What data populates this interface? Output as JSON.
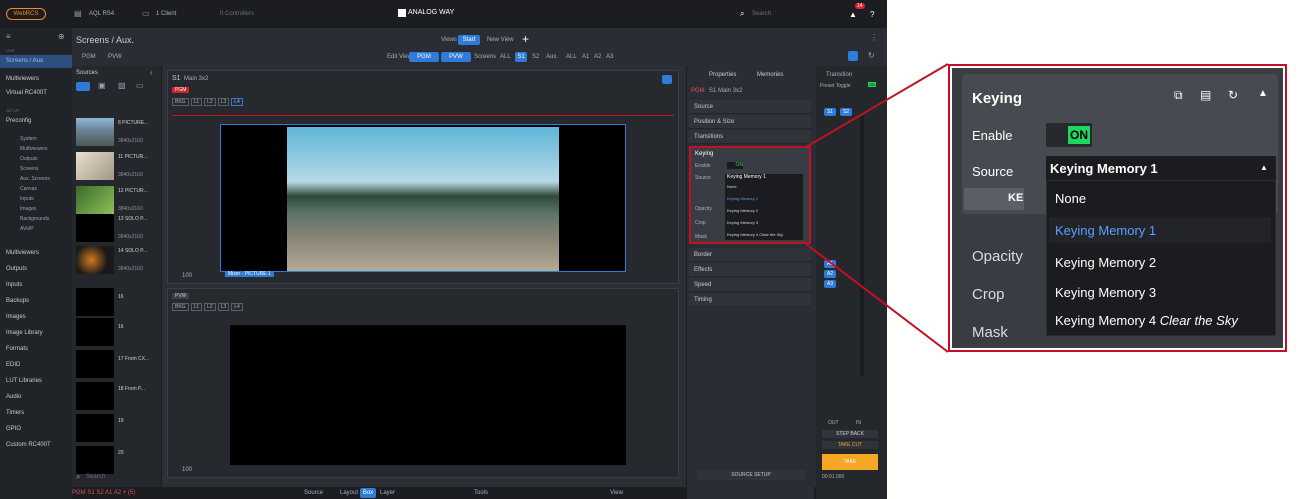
{
  "topbar": {
    "logo": "WebRCS",
    "device": "AQL RS4",
    "client": "1 Client",
    "controllers": "0 Controllers",
    "brand": "ANALOG WAY",
    "search_placeholder": "Search",
    "notif_count": "14"
  },
  "toolbar": {
    "section_title": "Screens / Aux.",
    "views_label": "Views",
    "start_label": "Start",
    "new_view": "New View",
    "pgm": "PGM",
    "pvw": "PVW",
    "edit_view": "Edit View",
    "screens_label": "Screens",
    "all": "ALL",
    "s1": "S1",
    "s2": "S2",
    "aux_label": "Aux.",
    "a1": "A1",
    "a2": "A2",
    "a3": "A3"
  },
  "nav": {
    "live_label": "LIVE",
    "items_top": [
      "Screens / Aux.",
      "Multiviewers",
      "Virtual RC400T"
    ],
    "setup_label": "SETUP",
    "preconfig": "Preconfig",
    "sub_items": [
      "System",
      "Multiviewers",
      "Outputs",
      "Screens",
      "Aux. Screens",
      "Canvas",
      "Inputs",
      "Images",
      "Backgrounds",
      "AVoIP"
    ],
    "items_bottom": [
      "Multiviewers",
      "Outputs",
      "Inputs",
      "Backups",
      "Images",
      "Image Library",
      "Formats",
      "EDID",
      "LUT Libraries",
      "Audio",
      "Timers",
      "GPIO",
      "Custom RC400T"
    ]
  },
  "sources": {
    "title": "Sources",
    "items": [
      {
        "name": "8 PICTURE...",
        "res": "3840x2160"
      },
      {
        "name": "11 PICTUR...",
        "res": "3840x2160"
      },
      {
        "name": "12 PICTUR...",
        "res": "3840x2160"
      },
      {
        "name": "13 SOLO P...",
        "res": "3840x2160"
      },
      {
        "name": "14 SOLO P...",
        "res": "3840x2160"
      },
      {
        "name": "16",
        "res": ""
      },
      {
        "name": "16",
        "res": ""
      },
      {
        "name": "17 From CX...",
        "res": ""
      },
      {
        "name": "18 From P...",
        "res": ""
      },
      {
        "name": "19",
        "res": ""
      },
      {
        "name": "20",
        "res": ""
      }
    ],
    "search": "Search"
  },
  "canvas": {
    "screen_title": "S1",
    "screen_name": "Main 3x2",
    "pgm_tag": "PGM",
    "layers": [
      "BKG",
      "L1",
      "L2",
      "L3",
      "L4"
    ],
    "layer_label": "Mixer",
    "layer_source": "PICTURE 1",
    "zoom": "100",
    "pvw_tag": "PVW"
  },
  "bottombar": {
    "pgm_list": "PGM S1 S2 A1 A2 + (5)",
    "source": "Source",
    "layout": "Layout",
    "box": "Box",
    "layer": "Layer",
    "tools": "Tools",
    "view": "View"
  },
  "props": {
    "properties": "Properties",
    "memories": "Memories",
    "screen_tag": "PGM",
    "screen_ref": "S1 Main 3x2",
    "rows": [
      "Source",
      "Position & Size",
      "Transitions"
    ],
    "rows_after": [
      "Border",
      "Effects",
      "Speed",
      "Timing"
    ],
    "source_setup": "SOURCE SETUP"
  },
  "transition": {
    "title": "Transition",
    "preset_toggle": "Preset Toggle",
    "on": "ON",
    "s1": "S1",
    "s2": "S2",
    "a1": "A1",
    "a2": "A2",
    "a3": "A3",
    "out": "OUT",
    "in": "IN",
    "step_back": "STEP BACK",
    "take_cut": "TAKE CUT",
    "take": "TAKE",
    "time": "00:01.000"
  },
  "keying": {
    "title": "Keying",
    "enable_label": "Enable",
    "enable_value": "ON",
    "source_label": "Source",
    "source_value": "Keying Memory 1",
    "options": [
      "None",
      "Keying Memory 1",
      "Keying Memory 2",
      "Keying Memory 3",
      "Keying Memory 4"
    ],
    "option4_suffix": "Clear the Sky",
    "below": [
      "Opacity",
      "Crop",
      "Mask"
    ],
    "hidden_button_fragment": "KE"
  },
  "colors": {
    "accent": "#2f7bd8",
    "highlight": "#c40f25",
    "on_green": "#1ed760",
    "take_orange": "#f5a623"
  }
}
